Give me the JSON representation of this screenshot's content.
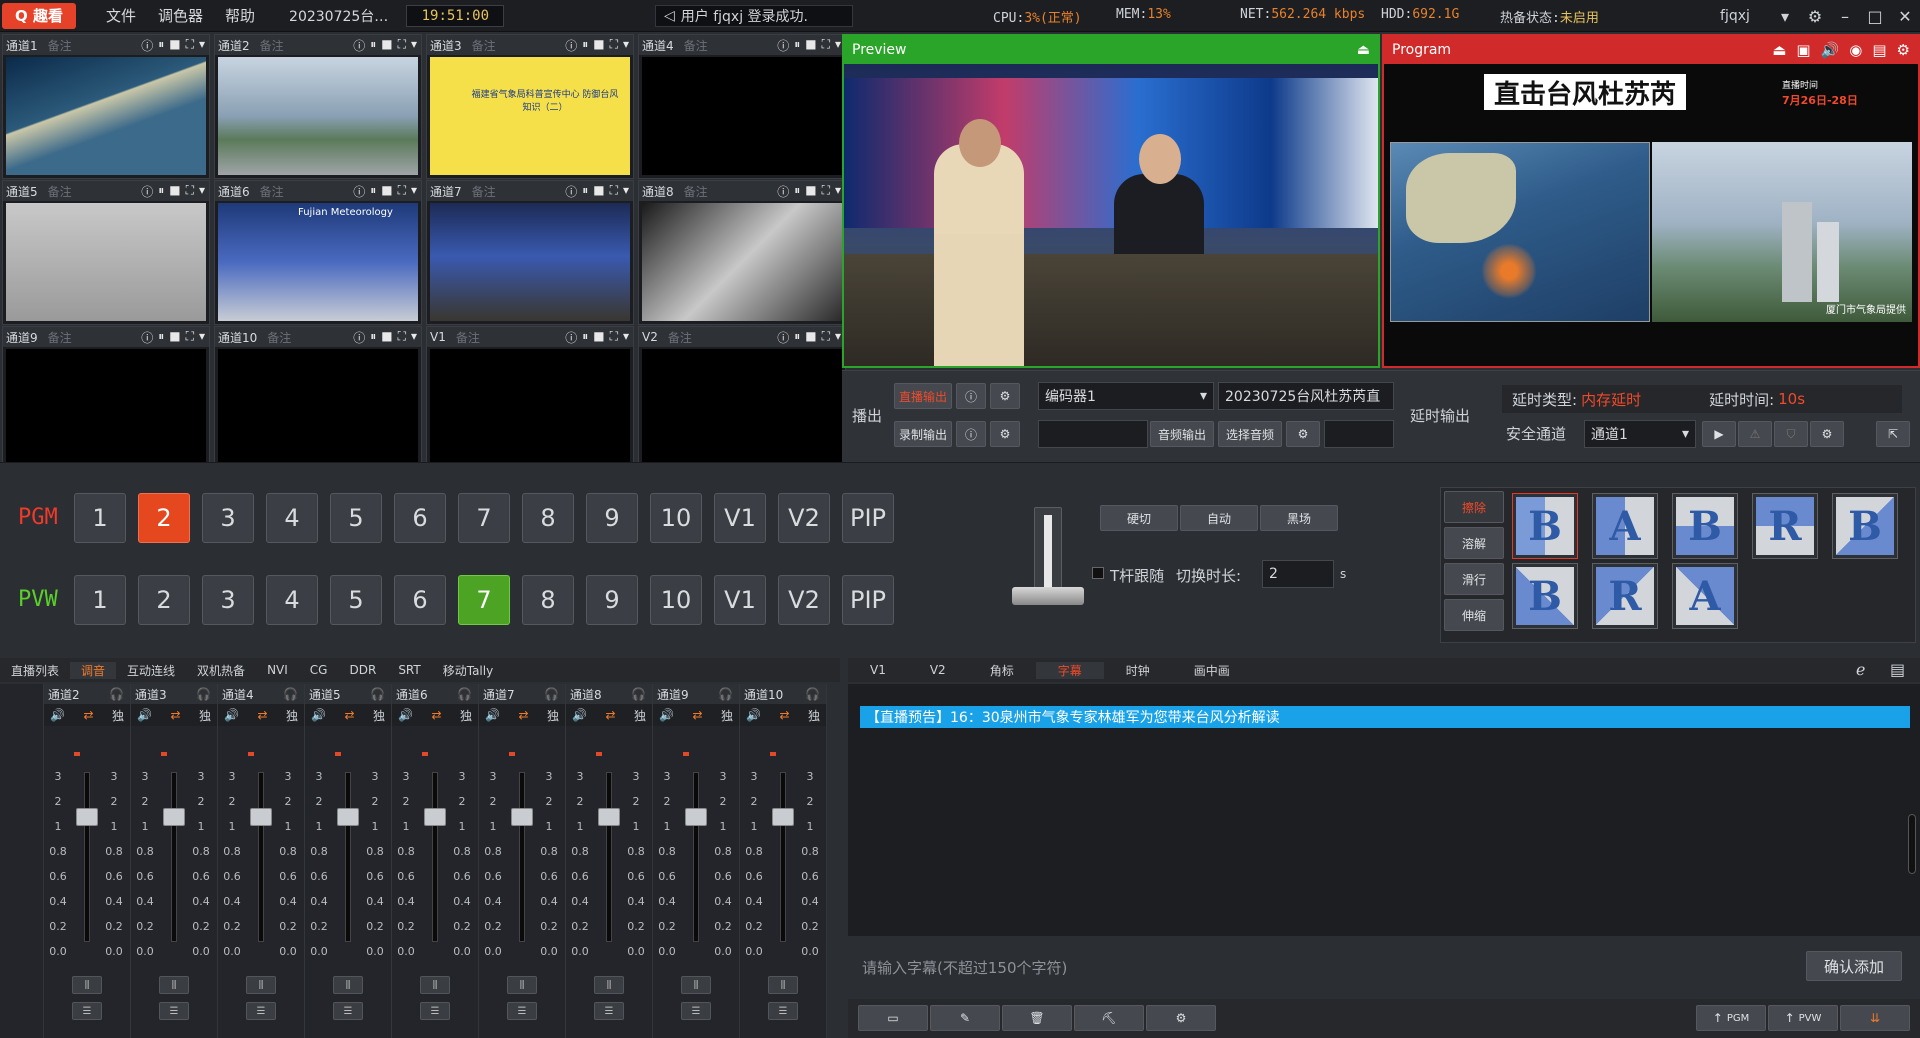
{
  "app": {
    "logo": "Q 趣看",
    "menu": [
      "文件",
      "调色器",
      "帮助"
    ],
    "date": "20230725台…",
    "clock": "19:51:00",
    "user_msg": "用户 fjqxj 登录成功.",
    "cpu_label": "CPU:",
    "cpu_value": "3%(正常)",
    "mem_label": "MEM:",
    "mem_value": "13%",
    "net_label": "NET:",
    "net_value": "562.264 kbps",
    "hdd_label": "HDD:",
    "hdd_value": "692.1G",
    "hot_label": "热备状态:",
    "hot_value": "未启用",
    "username": "fjqxj",
    "colors": {
      "accent": "#e6422a",
      "cpu": "#e8812b",
      "net": "#cfd3d8",
      "hot": "#e8c35a"
    }
  },
  "channels": [
    {
      "name": "通道1",
      "note": "备注"
    },
    {
      "name": "通道2",
      "note": "备注"
    },
    {
      "name": "通道3",
      "note": "备注"
    },
    {
      "name": "通道4",
      "note": "备注"
    },
    {
      "name": "通道5",
      "note": "备注"
    },
    {
      "name": "通道6",
      "note": "备注"
    },
    {
      "name": "通道7",
      "note": "备注"
    },
    {
      "name": "通道8",
      "note": "备注"
    },
    {
      "name": "通道9",
      "note": "备注"
    },
    {
      "name": "通道10",
      "note": "备注"
    },
    {
      "name": "V1",
      "note": "备注"
    },
    {
      "name": "V2",
      "note": "备注"
    }
  ],
  "thumb_text": {
    "ch3": "福建省气象局科普宣传中心 防御台风知识（二）",
    "ch6": "Fujian Meteorology"
  },
  "preview": {
    "label": "Preview"
  },
  "program": {
    "label": "Program",
    "title": "直击台风杜苏芮",
    "date_label": "直播时间",
    "date": "7月26日-28日",
    "caption": "厦门市气象局提供"
  },
  "output": {
    "broadcast_label": "播出",
    "live_out": "直播输出",
    "record_out": "录制输出",
    "encoder": "编码器1",
    "stream_name": "20230725台风杜苏芮直",
    "audio_out": "音频输出",
    "select_audio": "选择音频",
    "delay_label": "延时输出",
    "delay_type_label": "延时类型:",
    "delay_type": "内存延时",
    "delay_time_label": "延时时间:",
    "delay_time": "10s",
    "safe_channel_label": "安全通道",
    "safe_channel": "通道1"
  },
  "switcher": {
    "pgm_label": "PGM",
    "pvw_label": "PVW",
    "keys": [
      "1",
      "2",
      "3",
      "4",
      "5",
      "6",
      "7",
      "8",
      "9",
      "10",
      "V1",
      "V2",
      "PIP"
    ],
    "pgm_active": "2",
    "pvw_active": "7",
    "cut": "硬切",
    "auto": "自动",
    "black": "黑场",
    "t_follow": "T杆跟随",
    "duration_label": "切换时长:",
    "duration": "2",
    "duration_unit": "s",
    "effects": [
      "擦除",
      "溶解",
      "滑行",
      "伸缩"
    ]
  },
  "tabs_left": [
    "直播列表",
    "调音",
    "互动连线",
    "双机热备",
    "NVI",
    "CG",
    "DDR",
    "SRT",
    "移动Tally"
  ],
  "tabs_right": [
    "V1",
    "V2",
    "角标",
    "字幕",
    "时钟",
    "画中画"
  ],
  "mixer": {
    "channels": [
      "通道2",
      "通道3",
      "通道4",
      "通道5",
      "通道6",
      "通道7",
      "通道8",
      "通道9",
      "通道10"
    ],
    "solo": "独",
    "scale": [
      "3",
      "2",
      "1",
      "0.8",
      "0.6",
      "0.4",
      "0.2",
      "0.0"
    ]
  },
  "subtitle": {
    "line": "【直播预告】16：30泉州市气象专家林雄军为您带来台风分析解读",
    "placeholder": "请输入字幕(不超过150个字符)",
    "confirm": "确认添加"
  },
  "bottom": {
    "pgm": "PGM",
    "pvw": "PVW"
  }
}
